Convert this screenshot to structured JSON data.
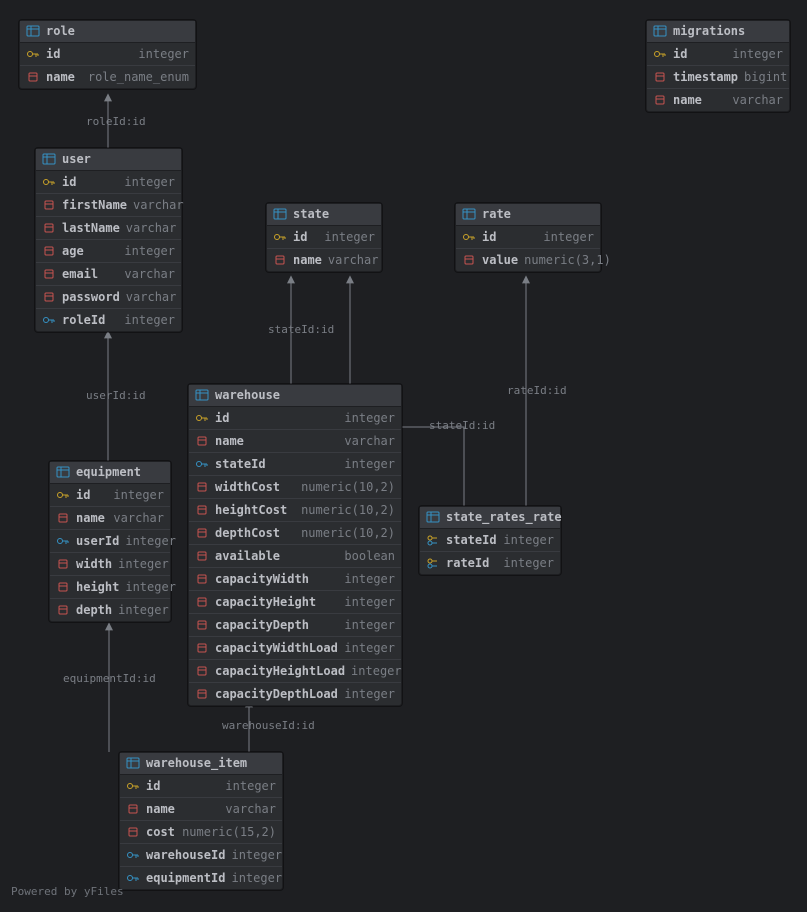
{
  "footer": "Powered by yFiles",
  "tables": {
    "role": {
      "name": "role",
      "cols": [
        {
          "n": "id",
          "t": "integer"
        },
        {
          "n": "name",
          "t": "role_name_enum"
        }
      ]
    },
    "migrations": {
      "name": "migrations",
      "cols": [
        {
          "n": "id",
          "t": "integer"
        },
        {
          "n": "timestamp",
          "t": "bigint"
        },
        {
          "n": "name",
          "t": "varchar"
        }
      ]
    },
    "user": {
      "name": "user",
      "cols": [
        {
          "n": "id",
          "t": "integer"
        },
        {
          "n": "firstName",
          "t": "varchar"
        },
        {
          "n": "lastName",
          "t": "varchar"
        },
        {
          "n": "age",
          "t": "integer"
        },
        {
          "n": "email",
          "t": "varchar"
        },
        {
          "n": "password",
          "t": "varchar"
        },
        {
          "n": "roleId",
          "t": "integer"
        }
      ]
    },
    "state": {
      "name": "state",
      "cols": [
        {
          "n": "id",
          "t": "integer"
        },
        {
          "n": "name",
          "t": "varchar"
        }
      ]
    },
    "rate": {
      "name": "rate",
      "cols": [
        {
          "n": "id",
          "t": "integer"
        },
        {
          "n": "value",
          "t": "numeric(3,1)"
        }
      ]
    },
    "warehouse": {
      "name": "warehouse",
      "cols": [
        {
          "n": "id",
          "t": "integer"
        },
        {
          "n": "name",
          "t": "varchar"
        },
        {
          "n": "stateId",
          "t": "integer"
        },
        {
          "n": "widthCost",
          "t": "numeric(10,2)"
        },
        {
          "n": "heightCost",
          "t": "numeric(10,2)"
        },
        {
          "n": "depthCost",
          "t": "numeric(10,2)"
        },
        {
          "n": "available",
          "t": "boolean"
        },
        {
          "n": "capacityWidth",
          "t": "integer"
        },
        {
          "n": "capacityHeight",
          "t": "integer"
        },
        {
          "n": "capacityDepth",
          "t": "integer"
        },
        {
          "n": "capacityWidthLoad",
          "t": "integer"
        },
        {
          "n": "capacityHeightLoad",
          "t": "integer"
        },
        {
          "n": "capacityDepthLoad",
          "t": "integer"
        }
      ]
    },
    "equipment": {
      "name": "equipment",
      "cols": [
        {
          "n": "id",
          "t": "integer"
        },
        {
          "n": "name",
          "t": "varchar"
        },
        {
          "n": "userId",
          "t": "integer"
        },
        {
          "n": "width",
          "t": "integer"
        },
        {
          "n": "height",
          "t": "integer"
        },
        {
          "n": "depth",
          "t": "integer"
        }
      ]
    },
    "state_rates_rate": {
      "name": "state_rates_rate",
      "cols": [
        {
          "n": "stateId",
          "t": "integer"
        },
        {
          "n": "rateId",
          "t": "integer"
        }
      ]
    },
    "warehouse_item": {
      "name": "warehouse_item",
      "cols": [
        {
          "n": "id",
          "t": "integer"
        },
        {
          "n": "name",
          "t": "varchar"
        },
        {
          "n": "cost",
          "t": "numeric(15,2)"
        },
        {
          "n": "warehouseId",
          "t": "integer"
        },
        {
          "n": "equipmentId",
          "t": "integer"
        }
      ]
    }
  },
  "edges": [
    {
      "from": "user.roleId",
      "to": "role.id",
      "label": "roleId:id"
    },
    {
      "from": "equipment.userId",
      "to": "user.id",
      "label": "userId:id"
    },
    {
      "from": "warehouse.stateId",
      "to": "state.id",
      "label": "stateId:id"
    },
    {
      "from": "state_rates_rate.stateId",
      "to": "state.id",
      "label": "stateId:id"
    },
    {
      "from": "state_rates_rate.rateId",
      "to": "rate.id",
      "label": "rateId:id"
    },
    {
      "from": "warehouse_item.equipmentId",
      "to": "equipment.id",
      "label": "equipmentId:id"
    },
    {
      "from": "warehouse_item.warehouseId",
      "to": "warehouse.id",
      "label": "warehouseId:id"
    }
  ]
}
